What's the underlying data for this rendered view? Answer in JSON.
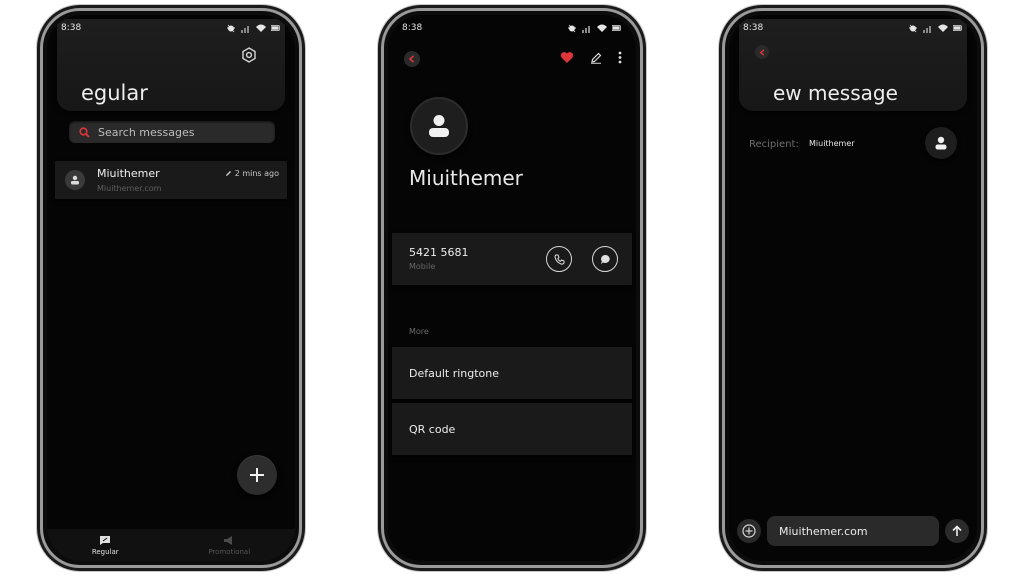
{
  "colors": {
    "accent_red": "#e0353b",
    "background": "#050505",
    "card": "#1a1a1a"
  },
  "status": {
    "time": "8:38"
  },
  "screen1": {
    "title": "egular",
    "search_placeholder": "Search messages",
    "conversation": {
      "name": "Miuithemer",
      "subtitle": "Miuithemer.com",
      "time": "2 mins ago"
    },
    "nav": {
      "regular": "Regular",
      "promotional": "Promotional"
    }
  },
  "screen2": {
    "contact_name": "Miuithemer",
    "number": "5421 5681",
    "number_type": "Mobile",
    "section_more": "More",
    "menu": {
      "ringtone": "Default ringtone",
      "qr": "QR code"
    }
  },
  "screen3": {
    "title": "ew message",
    "recipient_label": "Recipient:",
    "recipient_value": "Miuithemer",
    "compose_value": "Miuithemer.com"
  }
}
